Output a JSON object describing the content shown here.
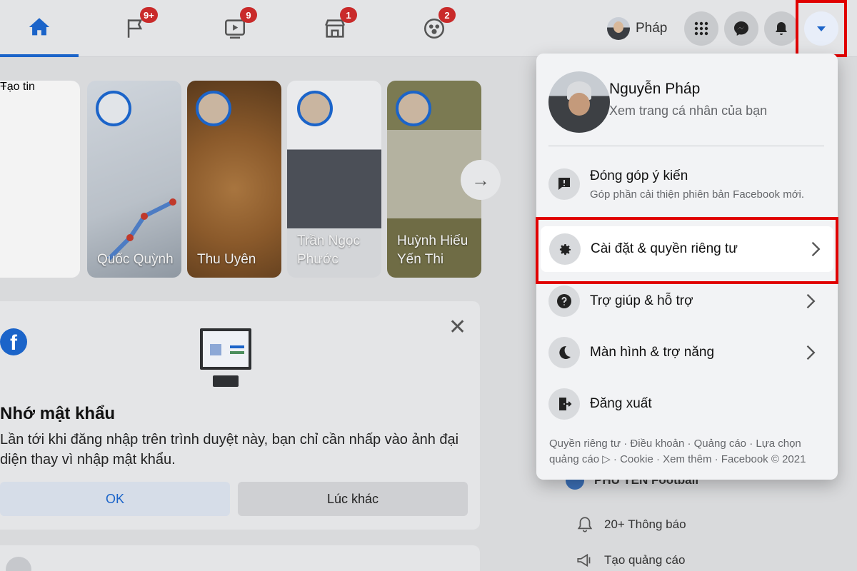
{
  "nav": {
    "tabs": [
      {
        "name": "home",
        "badge": ""
      },
      {
        "name": "pages",
        "badge": "9+"
      },
      {
        "name": "watch",
        "badge": "9"
      },
      {
        "name": "marketplace",
        "badge": "1"
      },
      {
        "name": "groups",
        "badge": "2"
      }
    ],
    "profile_name": "Pháp",
    "accent": "#1b64c9",
    "badge_color": "#c92a2a"
  },
  "stories": {
    "create_label": "Tạo tin",
    "items": [
      {
        "name": "Quốc Quỳnh"
      },
      {
        "name": "Thu Uyên"
      },
      {
        "name": "Trần Ngọc Phước"
      },
      {
        "name": "Huỳnh Hiếu Yến Thi"
      }
    ],
    "next_icon": "→"
  },
  "password_card": {
    "title": "Nhớ mật khẩu",
    "description": "Lần tới khi đăng nhập trên trình duyệt này, bạn chỉ cần nhấp vào ảnh đại diện thay vì nhập mật khẩu.",
    "ok_label": "OK",
    "later_label": "Lúc khác",
    "close_icon": "✕"
  },
  "right_column": {
    "page_name": "PHÚ YÊN Football",
    "notifications": "20+ Thông báo",
    "create_ad": "Tạo quảng cáo"
  },
  "menu": {
    "profile_name": "Nguyễn Pháp",
    "profile_sub": "Xem trang cá nhân của bạn",
    "feedback_title": "Đóng góp ý kiến",
    "feedback_sub": "Góp phần cải thiện phiên bản Facebook mới.",
    "items": [
      {
        "label": "Cài đặt & quyền riêng tư"
      },
      {
        "label": "Trợ giúp & hỗ trợ"
      },
      {
        "label": "Màn hình & trợ năng"
      },
      {
        "label": "Đăng xuất"
      }
    ],
    "footer": "Quyền riêng tư · Điều khoản · Quảng cáo · Lựa chọn quảng cáo ▷ · Cookie · Xem thêm · Facebook © 2021"
  },
  "highlight_color": "#e00000"
}
